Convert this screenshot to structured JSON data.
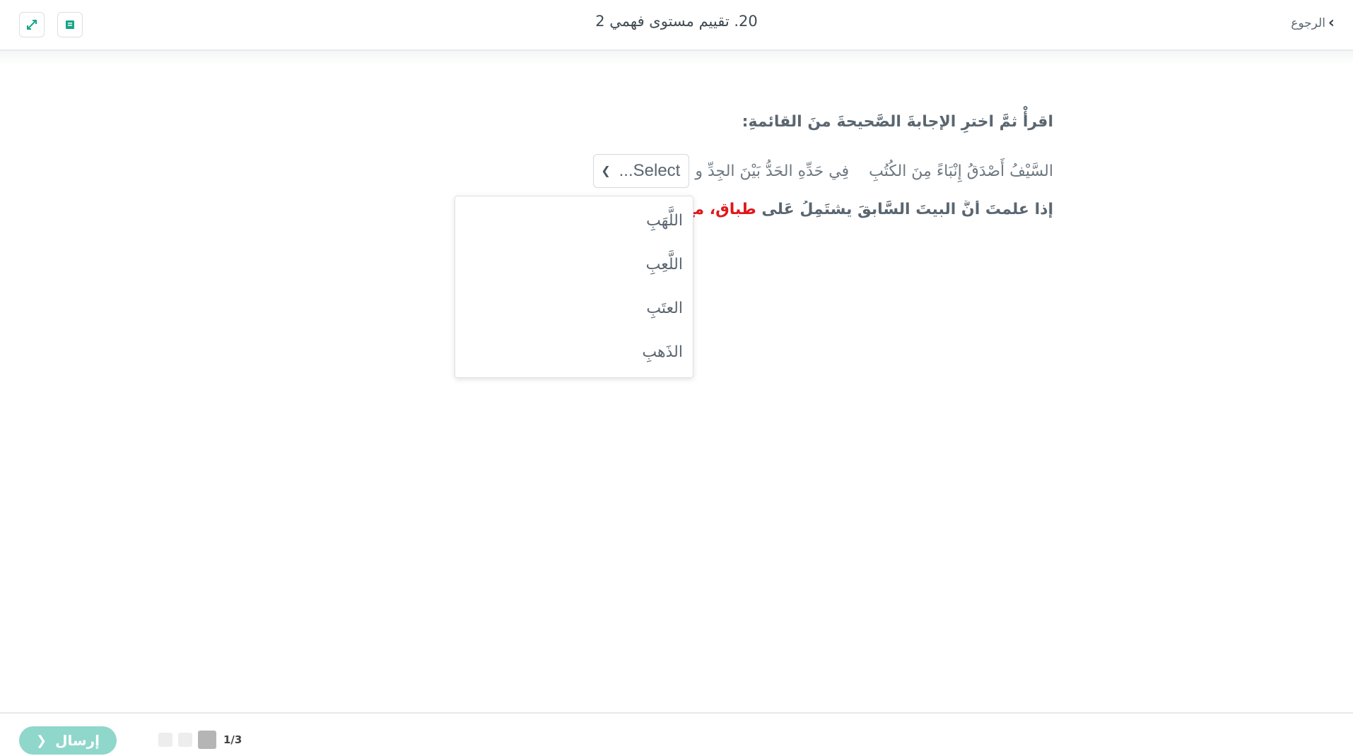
{
  "header": {
    "title": "20. تقييم مستوى فهمي 2",
    "back_label": "الرجوع",
    "back_icon": "chevron-right-icon",
    "expand_icon": "expand-icon",
    "book_icon": "book-icon",
    "accent": "#17a689"
  },
  "content": {
    "instruction": "اقرأْ ثمَّ اخترِ الإجابةَ الصَّحيحةَ منَ القائمةِ:",
    "verse_part1": "السَّيْفُ أَصْدَقُ إِنْبَاءً مِنَ الكُتُبِ",
    "verse_part2": "فِي حَدِّهِ الحَدُّ بَيْنَ الجِدِّ و",
    "select_placeholder": "Select...",
    "question_plain": "إذا علمتَ أنَّ البيتَ السَّابقَ يشتَمِلُ عَلى",
    "question_red1": "طباقٍ، معَ كلمةِ (ا",
    "dropdown_options": [
      "اللَّهَبِ",
      "اللَّعِبِ",
      "العتَبِ",
      "الذَهبِ"
    ]
  },
  "footer": {
    "send_label": "إرسال",
    "page_indicator": "1/3",
    "send_color": "#8fd6cb"
  }
}
